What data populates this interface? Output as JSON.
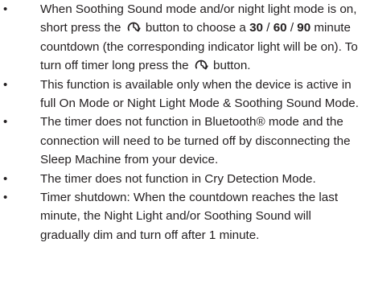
{
  "bullet_char": "•",
  "items": [
    {
      "parts": {
        "t1": "When Soothing Sound mode and/or night light mode is on, short press the ",
        "t2": " button to choose a ",
        "v30": "30",
        "sep1": " / ",
        "v60": "60",
        "sep2": " / ",
        "v90": "90",
        "t3": " minute countdown (the corresponding indicator light will be on). To turn off timer long press the ",
        "t4": " button."
      },
      "icons": [
        "timer-icon",
        "timer-icon"
      ]
    },
    {
      "text": "This function is available only when the device is active in full On Mode or Night Light Mode & Soothing Sound Mode."
    },
    {
      "text": "The timer does not function in Bluetooth® mode and the connection will need to be turned off by disconnecting the Sleep Machine from your device."
    },
    {
      "text": "The timer does not function in Cry Detection Mode."
    },
    {
      "text": "Timer shutdown: When the countdown reaches the last minute, the Night Light and/or Soothing Sound will gradually dim and turn off after 1 minute."
    }
  ]
}
